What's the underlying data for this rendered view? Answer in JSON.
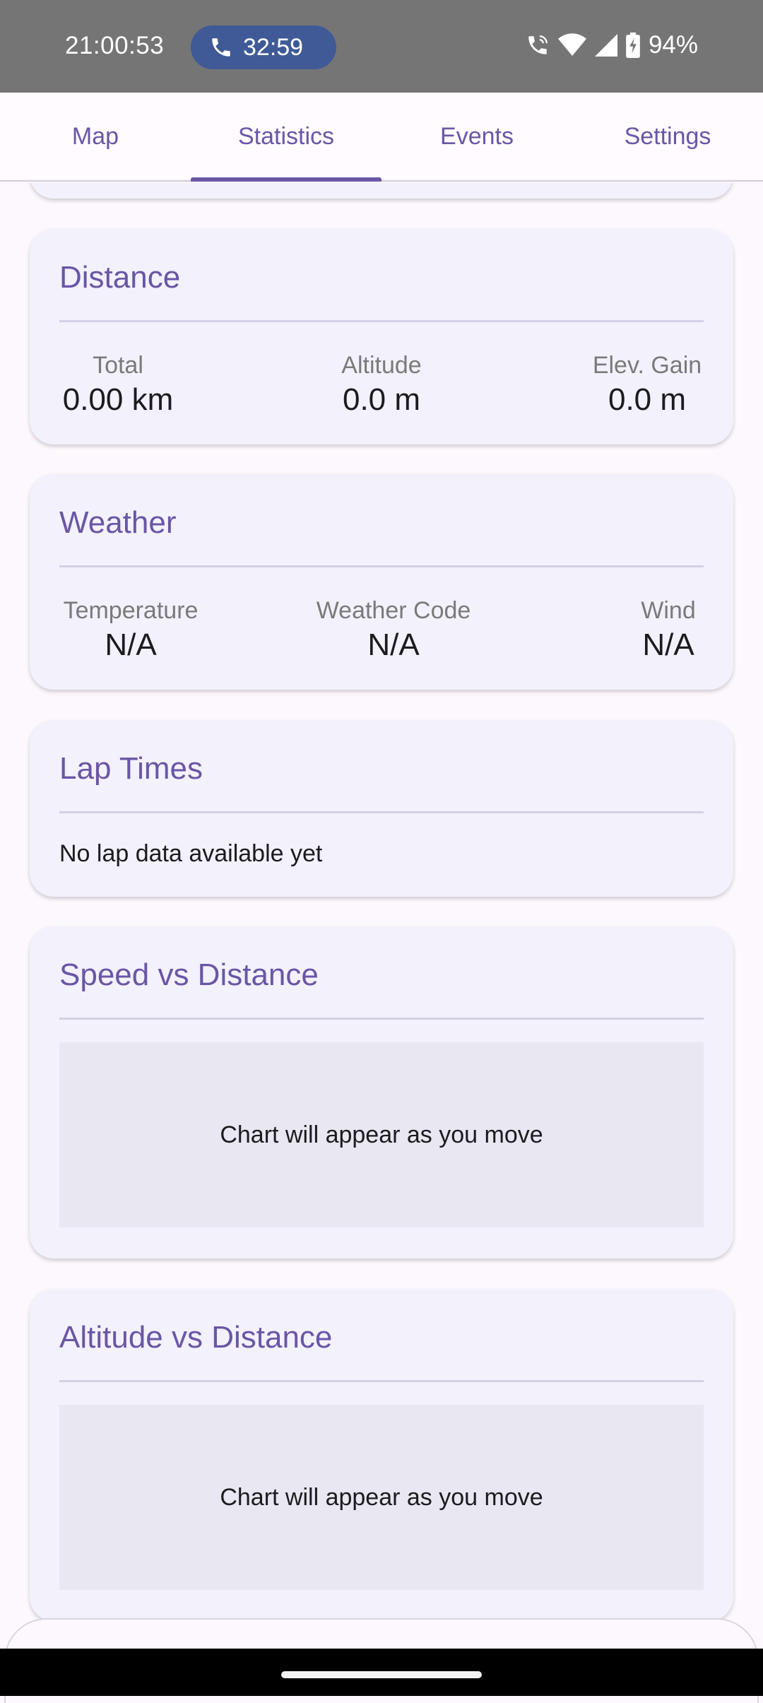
{
  "status_bar": {
    "time": "21:00:53",
    "call_duration": "32:59",
    "battery": "94%",
    "icons": [
      "phone-call-icon",
      "wifi-icon",
      "cell-signal-icon",
      "battery-charging-icon"
    ]
  },
  "tabs": [
    {
      "label": "Map",
      "active": false
    },
    {
      "label": "Statistics",
      "active": true
    },
    {
      "label": "Events",
      "active": false
    },
    {
      "label": "Settings",
      "active": false
    }
  ],
  "distance": {
    "title": "Distance",
    "stats": [
      {
        "label": "Total",
        "value": "0.00 km"
      },
      {
        "label": "Altitude",
        "value": "0.0 m"
      },
      {
        "label": "Elev. Gain",
        "value": "0.0 m"
      }
    ]
  },
  "weather": {
    "title": "Weather",
    "stats": [
      {
        "label": "Temperature",
        "value": "N/A"
      },
      {
        "label": "Weather Code",
        "value": "N/A"
      },
      {
        "label": "Wind",
        "value": "N/A"
      }
    ]
  },
  "lap_times": {
    "title": "Lap Times",
    "empty_text": "No lap data available yet"
  },
  "speed_chart": {
    "title": "Speed vs Distance",
    "placeholder": "Chart will appear as you move"
  },
  "altitude_chart": {
    "title": "Altitude vs Distance",
    "placeholder": "Chart will appear as you move"
  },
  "colors": {
    "accent": "#6a56a5",
    "card_bg": "#f3f1fc",
    "status_bar": "#757575",
    "call_pill": "#3f5a96"
  }
}
